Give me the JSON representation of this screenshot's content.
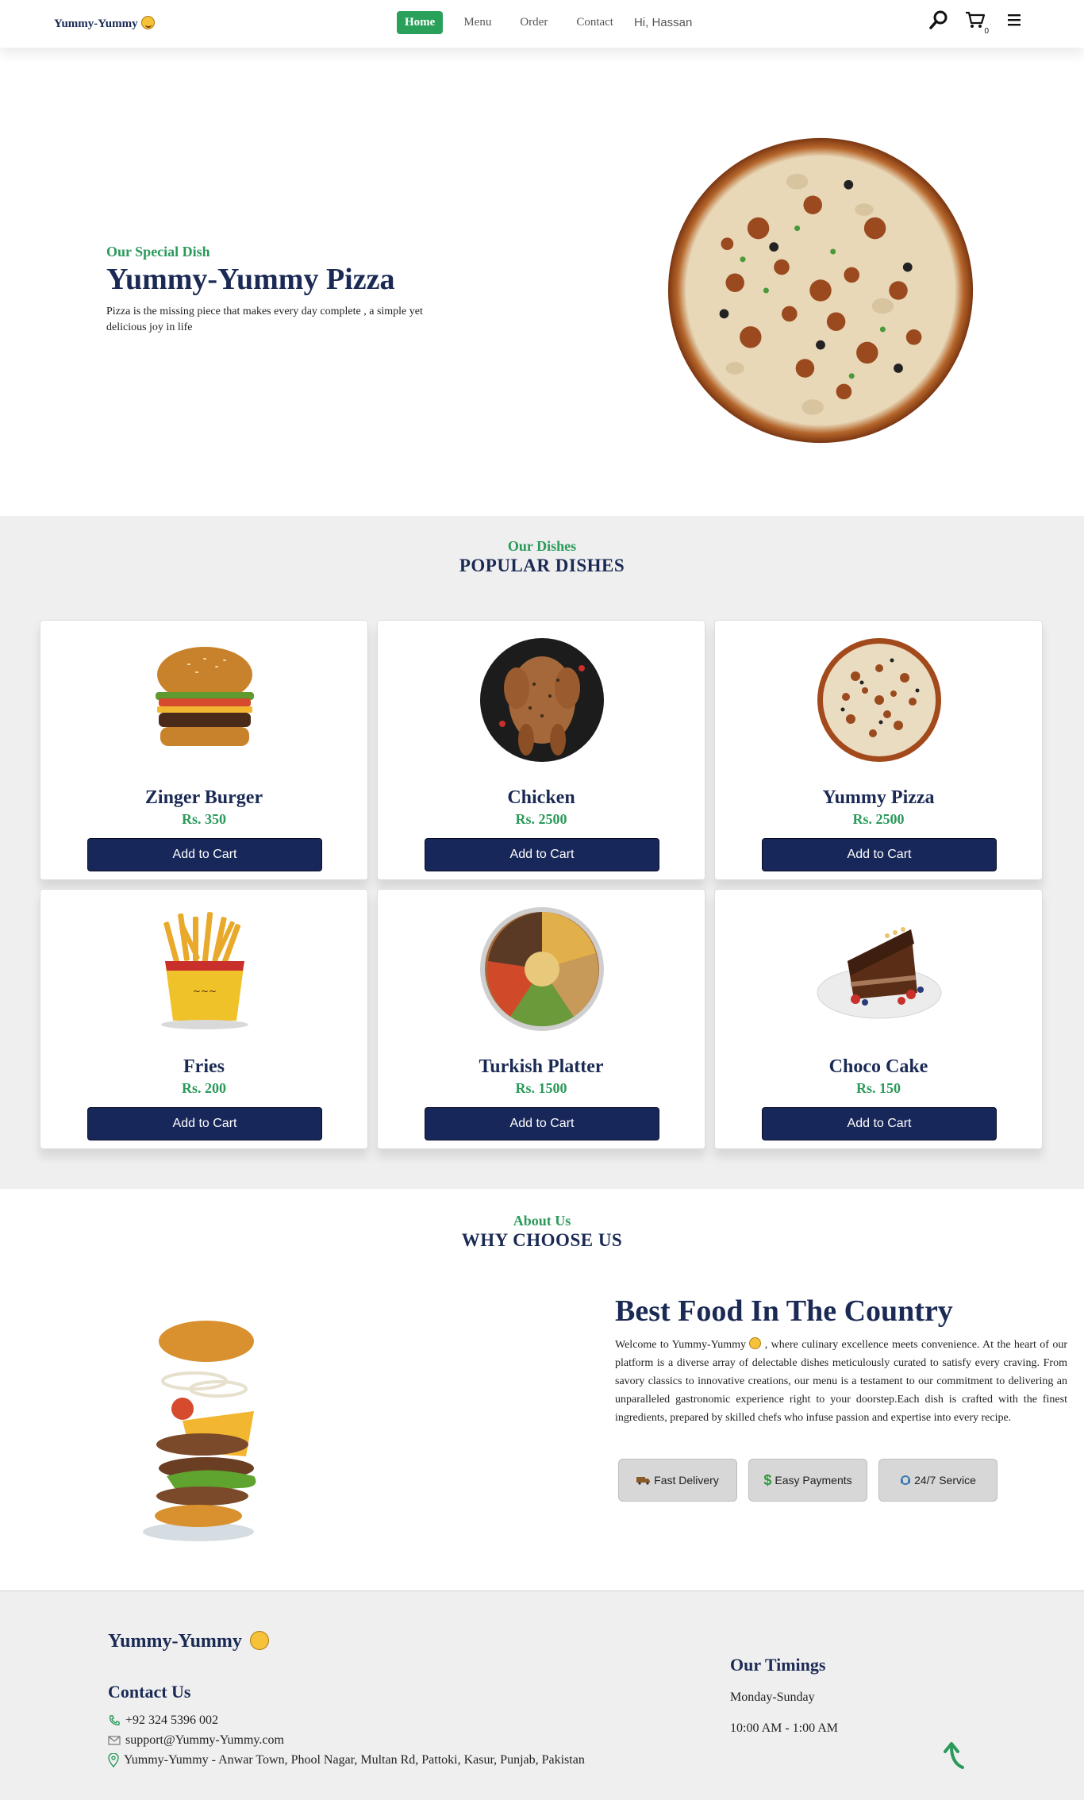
{
  "nav": {
    "brand": "Yummy-Yummy",
    "items": [
      {
        "label": "Home",
        "active": true
      },
      {
        "label": "Menu",
        "active": false
      },
      {
        "label": "Order",
        "active": false
      },
      {
        "label": "Contact",
        "active": false
      }
    ],
    "greeting": "Hi, Hassan",
    "cart_count": "0",
    "icons": [
      "search-icon",
      "cart-icon",
      "menu-icon"
    ]
  },
  "hero": {
    "subtitle": "Our Special Dish",
    "title": "Yummy-Yummy Pizza",
    "text": "Pizza is the missing piece that makes every day complete , a simple yet delicious joy in life"
  },
  "dishes": {
    "subtitle": "Our Dishes",
    "title": "POPULAR DISHES",
    "items": [
      {
        "name": "Zinger Burger",
        "price": "Rs. 350",
        "button": "Add to Cart",
        "image": "burger"
      },
      {
        "name": "Chicken",
        "price": "Rs. 2500",
        "button": "Add to Cart",
        "image": "chicken"
      },
      {
        "name": "Yummy Pizza",
        "price": "Rs. 2500",
        "button": "Add to Cart",
        "image": "pizza"
      },
      {
        "name": "Fries",
        "price": "Rs. 200",
        "button": "Add to Cart",
        "image": "fries"
      },
      {
        "name": "Turkish Platter",
        "price": "Rs. 1500",
        "button": "Add to Cart",
        "image": "platter"
      },
      {
        "name": "Choco Cake",
        "price": "Rs. 150",
        "button": "Add to Cart",
        "image": "cake"
      }
    ]
  },
  "about": {
    "subtitle": "About Us",
    "title": "WHY CHOOSE US",
    "heading": "Best Food In The Country",
    "text_before_emoji": "Welcome to Yummy-Yummy",
    "text_after_emoji": ", where culinary excellence meets convenience. At the heart of our platform is a diverse array of delectable dishes meticulously curated to satisfy every craving. From savory classics to innovative creations, our menu is a testament to our commitment to delivering an unparalleled gastronomic experience right to your doorstep.Each dish is crafted with the finest ingredients, prepared by skilled chefs who infuse passion and expertise into every recipe.",
    "features": [
      {
        "label": "Fast Delivery",
        "icon": "truck-icon"
      },
      {
        "label": "Easy Payments",
        "icon": "dollar-icon"
      },
      {
        "label": "24/7 Service",
        "icon": "support-icon"
      }
    ]
  },
  "footer": {
    "brand": "Yummy-Yummy",
    "contact_title": "Contact Us",
    "phone": "+92 324 5396 002",
    "email": "support@Yummy-Yummy.com",
    "address": "Yummy-Yummy - Anwar Town, Phool Nagar, Multan Rd, Pattoki, Kasur, Punjab, Pakistan",
    "timings_title": "Our Timings",
    "days": "Monday-Sunday",
    "hours": "10:00 AM - 1:00 AM"
  },
  "colors": {
    "navy": "#1b2a55",
    "green": "#2aa15a",
    "button": "#18275a",
    "section_bg": "#efefef"
  }
}
